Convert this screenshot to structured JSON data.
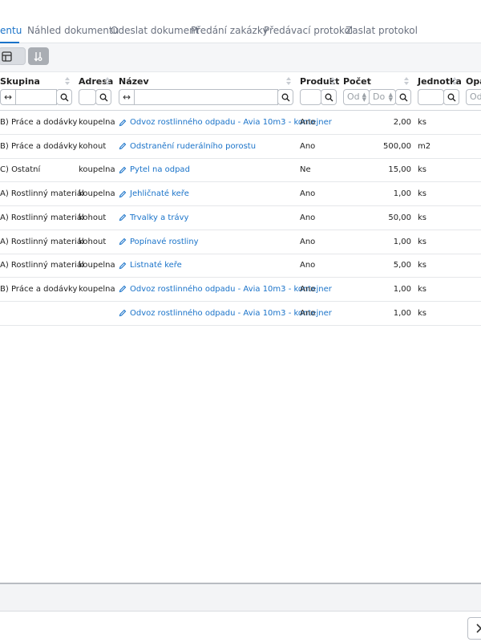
{
  "tabs": [
    {
      "label": "entu",
      "active": true
    },
    {
      "label": "Náhled dokumentu",
      "active": false
    },
    {
      "label": "Odeslat dokument",
      "active": false
    },
    {
      "label": "Předání zakázky",
      "active": false
    },
    {
      "label": "Předávací protokol",
      "active": false
    },
    {
      "label": "Zaslat protokol",
      "active": false
    }
  ],
  "columns": {
    "skupina": "Skupina",
    "adresa": "Adresa",
    "nazev": "Název",
    "produkt": "Produkt",
    "pocet": "Počet",
    "jednotka": "Jednotka",
    "opa": "Opa"
  },
  "filters": {
    "swap_symbol": "↔",
    "pocet_from": "Od",
    "pocet_to": "Do",
    "opa_placeholder": "Od"
  },
  "rows": [
    {
      "skupina": "B) Práce a dodávky",
      "adresa": "koupelna",
      "nazev": "Odvoz rostlinného odpadu - Avia 10m3 - kontejner",
      "produkt": "Ano",
      "pocet": "2,00",
      "jednotka": "ks"
    },
    {
      "skupina": "B) Práce a dodávky",
      "adresa": "kohout",
      "nazev": "Odstranění ruderálního porostu",
      "produkt": "Ano",
      "pocet": "500,00",
      "jednotka": "m2"
    },
    {
      "skupina": "C) Ostatní",
      "adresa": "koupelna",
      "nazev": "Pytel na odpad",
      "produkt": "Ne",
      "pocet": "15,00",
      "jednotka": "ks"
    },
    {
      "skupina": "A) Rostlinný materiál",
      "adresa": "koupelna",
      "nazev": "Jehličnaté keře",
      "produkt": "Ano",
      "pocet": "1,00",
      "jednotka": "ks"
    },
    {
      "skupina": "A) Rostlinný materiál",
      "adresa": "kohout",
      "nazev": "Trvalky a trávy",
      "produkt": "Ano",
      "pocet": "50,00",
      "jednotka": "ks"
    },
    {
      "skupina": "A) Rostlinný materiál",
      "adresa": "kohout",
      "nazev": "Popínavé rostliny",
      "produkt": "Ano",
      "pocet": "1,00",
      "jednotka": "ks"
    },
    {
      "skupina": "A) Rostlinný materiál",
      "adresa": "koupelna",
      "nazev": "Listnaté keře",
      "produkt": "Ano",
      "pocet": "5,00",
      "jednotka": "ks"
    },
    {
      "skupina": "B) Práce a dodávky",
      "adresa": "koupelna",
      "nazev": "Odvoz rostlinného odpadu - Avia 10m3 - kontejner",
      "produkt": "Ano",
      "pocet": "1,00",
      "jednotka": "ks"
    },
    {
      "skupina": "",
      "adresa": "",
      "nazev": "Odvoz rostlinného odpadu - Avia 10m3 - kontejner",
      "produkt": "Ano",
      "pocet": "1,00",
      "jednotka": "ks"
    }
  ],
  "icons": {
    "toolbar_grid": "table-grid-icon",
    "toolbar_sort": "sort-settings-icon",
    "search": "search-icon",
    "edit": "pencil-icon",
    "next": "chevron-right-icon"
  },
  "colors": {
    "accent": "#1a73c9",
    "text": "#222222",
    "muted": "#6b7280"
  }
}
